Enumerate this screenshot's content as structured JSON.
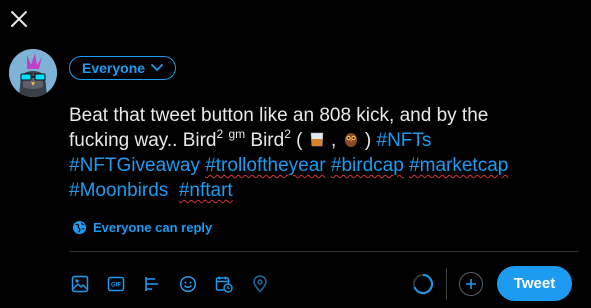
{
  "header": {
    "close_icon": "close-icon"
  },
  "composer": {
    "audience_label": "Everyone",
    "text": {
      "line1": "Beat that tweet button like an 808 kick, and by the",
      "line2_prefix": "fucking way.. Bird",
      "sup1": "2",
      "gm": "gm",
      "bird2": "Bird",
      "sup2": "2",
      "open_paren": " (",
      "comma": " ,",
      "close_paren": ")",
      "tag_nfts": "#NFTs",
      "tag_nftgiveaway": "#NFTGiveaway",
      "tag_trolloftheyear": "#trolloftheyear",
      "tag_birdcap": "#birdcap",
      "tag_marketcap": "#marketcap",
      "tag_moonbirds": "#Moonbirds",
      "tag_nftart": "#nftart"
    },
    "reply_setting": "Everyone can reply"
  },
  "toolbar": {
    "icons": [
      "image-icon",
      "gif-icon",
      "poll-icon",
      "emoji-icon",
      "schedule-icon",
      "location-icon"
    ],
    "tweet_label": "Tweet"
  },
  "colors": {
    "accent": "#1d9bf0",
    "background": "#000000",
    "text": "#e7e9ea"
  }
}
